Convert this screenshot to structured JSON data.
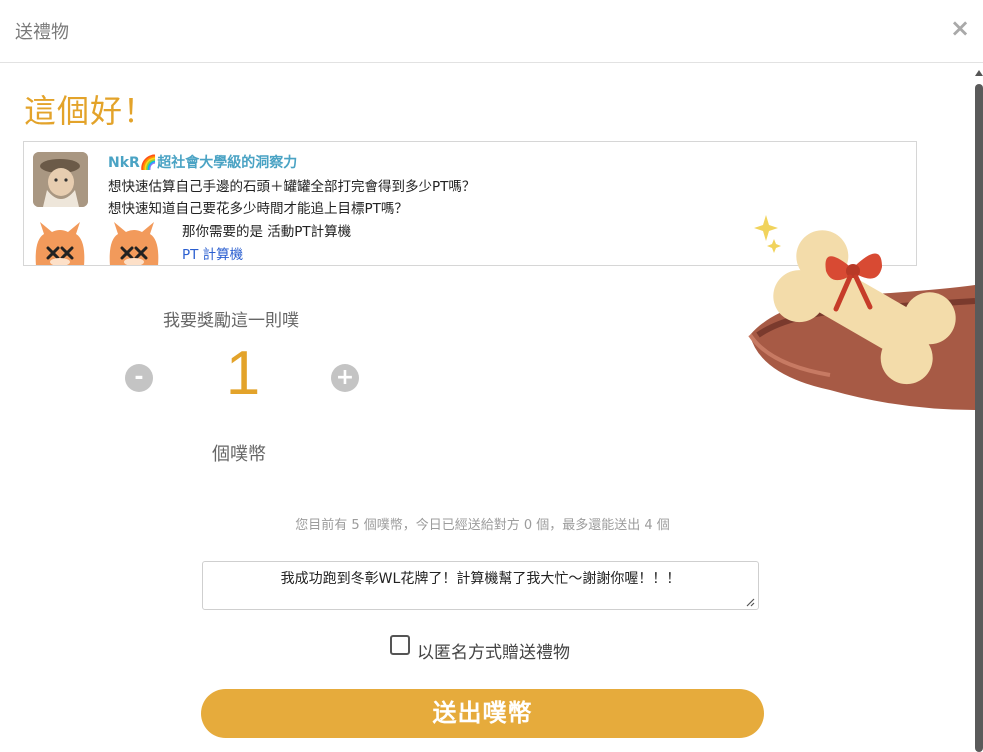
{
  "dialog": {
    "title": "送禮物",
    "close_label": "×"
  },
  "headline": "這個好！",
  "plurk": {
    "author": "NkR🌈超社會大學級的洞察力",
    "lines": [
      "想快速估算自己手邊的石頭＋罐罐全部打完會得到多少PT嗎？",
      "想快速知道自己要花多少時間才能追上目標PT嗎？",
      "那你需要的是 活動PT計算機"
    ],
    "link_text": "PT 計算機"
  },
  "reward": {
    "label": "我要獎勵這一則噗",
    "minus_label": "-",
    "plus_label": "+",
    "count": "1",
    "unit": "個噗幣"
  },
  "info": "您目前有 5 個噗幣，今日已經送給對方 0 個，最多還能送出 4 個",
  "message": {
    "value": "我成功跑到冬彰WL花牌了！計算機幫了我大忙～謝謝你喔！！！"
  },
  "anonymous": {
    "label": "以匿名方式贈送禮物",
    "checked": false
  },
  "send_button": "送出噗幣",
  "colors": {
    "accent": "#e3a32a",
    "button": "#e6ab3c",
    "author": "#4aa3c4",
    "link": "#2b5fd0"
  },
  "icons": {
    "close": "close-icon",
    "minus": "minus-icon",
    "plus": "plus-icon",
    "resize": "resize-handle-icon",
    "illustration": "bone-gift-illustration"
  }
}
